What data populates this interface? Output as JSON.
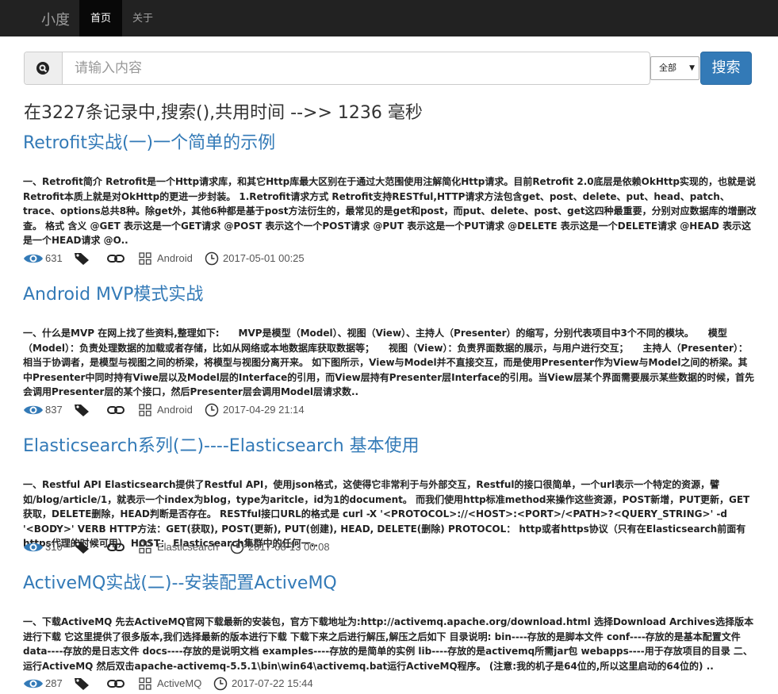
{
  "nav": {
    "brand": "小度",
    "home": "首页",
    "about": "关于"
  },
  "search": {
    "placeholder": "请输入内容",
    "value": "",
    "scope": "全部",
    "button": "搜索"
  },
  "summary": "在3227条记录中,搜索(),共用时间 -->> 1236 毫秒",
  "results": [
    {
      "title": "Retrofit实战(一)一个简单的示例",
      "body": "一、Retrofit简介 Retrofit是一个Http请求库，和其它Http库最大区别在于通过大范围使用注解简化Http请求。目前Retrofit 2.0底层是依赖OkHttp实现的，也就是说Retrofit本质上就是对OkHttp的更进一步封装。 1.Retrofit请求方式 Retrofit支持RESTful,HTTP请求方法包含get、post、delete、put、head、patch、trace、options总共8种。除get外，其他6种都是基于post方法衍生的，最常见的是get和post，而put、delete、post、get这四种最重要，分别对应数据库的增删改查。 格式 含义 @GET 表示这是一个GET请求 @POST 表示这个一个POST请求 @PUT 表示这是一个PUT请求 @DELETE 表示这是一个DELETE请求 @HEAD 表示这是一个HEAD请求 @O..",
      "views": "631",
      "category": "Android",
      "date": "2017-05-01 00:25"
    },
    {
      "title": "Android MVP模式实战",
      "body": "一、什么是MVP 在网上找了些资料,整理如下:　　MVP是模型（Model）、视图（View）、主持人（Presenter）的缩写，分别代表项目中3个不同的模块。　　模型（Model）：负责处理数据的加载或者存储，比如从网络或本地数据库获取数据等；　　视图（View）：负责界面数据的展示，与用户进行交互；　　主持人（Presenter）：相当于协调者，是模型与视图之间的桥梁，将模型与视图分离开来。 如下图所示，View与Model并不直接交互，而是使用Presenter作为View与Model之间的桥梁。其中Presenter中同时持有Viwe层以及Model层的Interface的引用，而View层持有Presenter层Interface的引用。当View层某个界面需要展示某些数据的时候，首先会调用Presenter层的某个接口，然后Presenter层会调用Model层请求数..",
      "views": "837",
      "category": "Android",
      "date": "2017-04-29 21:14"
    },
    {
      "title": "Elasticsearch系列(二)----Elasticsearch 基本使用",
      "body": "一、Restful API Elasticsearch提供了Restful API，使用json格式，这使得它非常利于与外部交互，Restful的接口很简单，一个url表示一个特定的资源，譬如/blog/article/1，就表示一个index为blog，type为aritcle，id为1的document。 而我们使用http标准method来操作这些资源，POST新增，PUT更新，GET获取，DELETE删除，HEAD判断是否存在。 RESTful接口URL的格式是 curl -X '<PROTOCOL>://<HOST>:<PORT>/<PATH>?<QUERY_STRING>' -d '<BODY>' VERB HTTP方法：GET(获取), POST(更新), PUT(创建), HEAD, DELETE(删除) PROTOCOL： http或者https协议（只有在Elasticsearch前面有https代理的时候可用） HOST： Elasticsearch集群中的任何一..",
      "views": "310",
      "category": "Elasticsearch",
      "date": "2017-08-13 00:08"
    },
    {
      "title": "ActiveMQ实战(二)--安装配置ActiveMQ",
      "body": "一、下载ActiveMQ 先去ActiveMQ官网下载最新的安装包，官方下载地址为:http://activemq.apache.org/download.html 选择Download Archives选择版本进行下载 它这里提供了很多版本,我们选择最新的版本进行下载 下载下来之后进行解压,解压之后如下 目录说明: bin----存放的是脚本文件 conf----存放的是基本配置文件 data----存放的是日志文件 docs----存放的是说明文档 examples----存放的是简单的实例 lib----存放的是activemq所需jar包 webapps----用于存放项目的目录 二、运行ActiveMQ 然后双击apache-activemq-5.5.1\\bin\\win64\\activemq.bat运行ActiveMQ程序。 (注意:我的机子是64位的,所以这里启动的64位的) ..",
      "views": "287",
      "category": "ActiveMQ",
      "date": "2017-07-22 15:44"
    }
  ],
  "colors": {
    "navbar": "#222222",
    "link": "#337ab7",
    "button": "#337ab7",
    "text": "#222222"
  },
  "icons": [
    "search-logo-icon",
    "eye-icon",
    "tag-icon",
    "link-icon",
    "category-icon",
    "clock-icon"
  ]
}
